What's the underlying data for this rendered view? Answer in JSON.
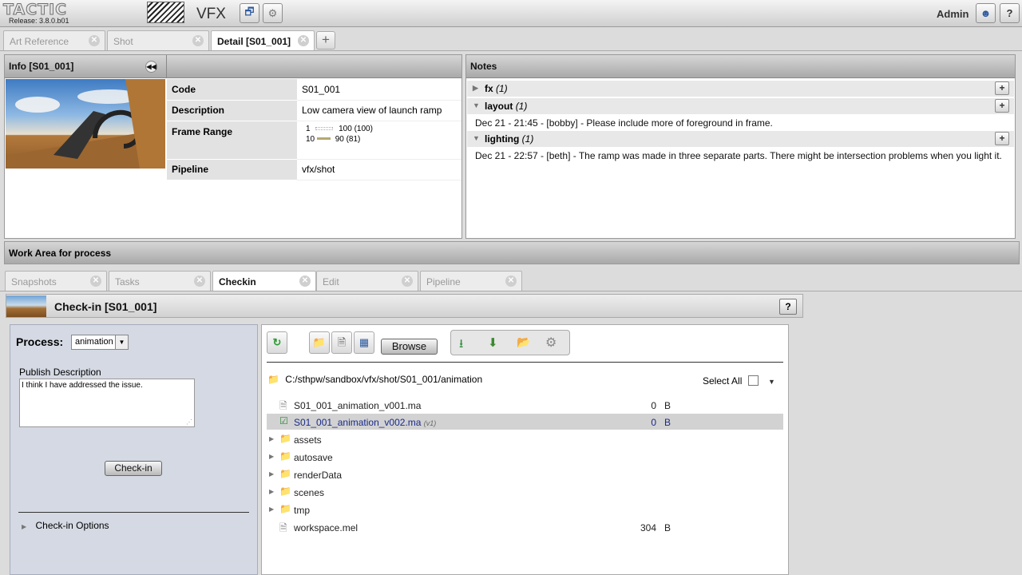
{
  "app": {
    "logo": "TACTIC",
    "release": "Release: 3.8.0.b01",
    "project_title": "VFX",
    "user": "Admin"
  },
  "main_tabs": [
    {
      "label": "Art Reference"
    },
    {
      "label": "Shot"
    },
    {
      "label": "Detail [S01_001]"
    }
  ],
  "info": {
    "title": "Info [S01_001]",
    "rows": [
      {
        "key": "Code",
        "value": "S01_001"
      },
      {
        "key": "Description",
        "value": "Low camera view of launch ramp"
      },
      {
        "key": "Frame Range",
        "value": ""
      },
      {
        "key": "Pipeline",
        "value": "vfx/shot"
      }
    ],
    "frame_range": {
      "line1": {
        "start": "1",
        "end": "100 (100)"
      },
      "line2": {
        "start": "10",
        "end": "90 (81)"
      }
    }
  },
  "notes": {
    "title": "Notes",
    "groups": [
      {
        "name": "fx",
        "count": "(1)"
      },
      {
        "name": "layout",
        "count": "(1)",
        "text": "Dec 21 - 21:45 - [bobby] - Please include more of foreground in frame."
      },
      {
        "name": "lighting",
        "count": "(1)",
        "text": "Dec 21 - 22:57 - [beth] - The ramp was made in three separate parts. There might be intersection problems when you light it."
      }
    ]
  },
  "work_area": {
    "title": "Work Area for process",
    "tabs": [
      {
        "label": "Snapshots"
      },
      {
        "label": "Tasks"
      },
      {
        "label": "Checkin"
      },
      {
        "label": "Edit"
      },
      {
        "label": "Pipeline"
      }
    ]
  },
  "checkin": {
    "title": "Check-in [S01_001]",
    "process_label": "Process:",
    "process_value": "animation",
    "publish_label": "Publish Description",
    "publish_text": "I think I have addressed the issue.",
    "checkin_button": "Check-in",
    "options_label": "Check-in Options",
    "browse_button": "Browse",
    "path": "C:/sthpw/sandbox/vfx/shot/S01_001/animation",
    "select_all": "Select All",
    "files": [
      {
        "name": "S01_001_animation_v001.ma",
        "size": "0",
        "unit": "B",
        "type": "file"
      },
      {
        "name": "S01_001_animation_v002.ma",
        "version": "(v1)",
        "size": "0",
        "unit": "B",
        "type": "checked"
      },
      {
        "name": "assets",
        "type": "folder"
      },
      {
        "name": "autosave",
        "type": "folder"
      },
      {
        "name": "renderData",
        "type": "folder"
      },
      {
        "name": "scenes",
        "type": "folder"
      },
      {
        "name": "tmp",
        "type": "folder"
      },
      {
        "name": "workspace.mel",
        "size": "304",
        "unit": "B",
        "type": "file"
      }
    ]
  },
  "colors": {
    "accent": "#2c5a9e",
    "checkin_bg": "#d4d9e3",
    "selected_row": "#d2d2d2"
  }
}
